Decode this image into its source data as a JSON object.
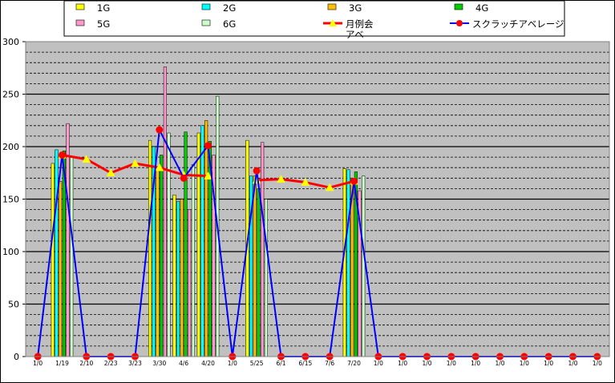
{
  "chart_data": {
    "type": "bar",
    "title": "",
    "xlabel": "",
    "ylabel": "",
    "ylim": [
      0,
      300
    ],
    "yticks": [
      0,
      50,
      100,
      150,
      200,
      250,
      300
    ],
    "grid": true,
    "legend_position": "top",
    "plot_background": "#c0c0c0",
    "categories": [
      "1/0",
      "1/19",
      "2/10",
      "2/23",
      "3/23",
      "3/30",
      "4/6",
      "4/20",
      "1/0",
      "5/25",
      "6/1",
      "6/15",
      "7/6",
      "7/20",
      "1/0",
      "1/0",
      "1/0",
      "1/0",
      "1/0",
      "1/0",
      "1/0",
      "1/0",
      "1/0",
      "1/0"
    ],
    "series": [
      {
        "name": "1G",
        "kind": "bar",
        "color": "#ffff00",
        "values": [
          0,
          184,
          0,
          0,
          0,
          206,
          154,
          213,
          0,
          206,
          0,
          0,
          0,
          179,
          0,
          0,
          0,
          0,
          0,
          0,
          0,
          0,
          0,
          0
        ]
      },
      {
        "name": "2G",
        "kind": "bar",
        "color": "#00ffff",
        "values": [
          0,
          197,
          0,
          0,
          0,
          200,
          148,
          220,
          0,
          172,
          0,
          0,
          0,
          178,
          0,
          0,
          0,
          0,
          0,
          0,
          0,
          0,
          0,
          0
        ]
      },
      {
        "name": "3G",
        "kind": "bar",
        "color": "#ffc000",
        "values": [
          0,
          167,
          0,
          0,
          0,
          178,
          150,
          225,
          0,
          172,
          0,
          0,
          0,
          170,
          0,
          0,
          0,
          0,
          0,
          0,
          0,
          0,
          0,
          0
        ]
      },
      {
        "name": "4G",
        "kind": "bar",
        "color": "#00cc00",
        "values": [
          0,
          196,
          0,
          0,
          0,
          192,
          214,
          205,
          0,
          160,
          0,
          0,
          0,
          176,
          0,
          0,
          0,
          0,
          0,
          0,
          0,
          0,
          0,
          0
        ]
      },
      {
        "name": "5G",
        "kind": "bar",
        "color": "#ff99cc",
        "values": [
          0,
          222,
          0,
          0,
          0,
          276,
          140,
          192,
          0,
          204,
          0,
          0,
          0,
          158,
          0,
          0,
          0,
          0,
          0,
          0,
          0,
          0,
          0,
          0
        ]
      },
      {
        "name": "6G",
        "kind": "bar",
        "color": "#ccffcc",
        "values": [
          0,
          190,
          0,
          0,
          0,
          213,
          183,
          248,
          0,
          150,
          0,
          0,
          0,
          172,
          0,
          0,
          0,
          0,
          0,
          0,
          0,
          0,
          0,
          0
        ]
      },
      {
        "name": "月例会アベ",
        "kind": "line",
        "color": "#ff0000",
        "marker": "triangle",
        "marker_color": "#ffff00",
        "values": [
          null,
          192,
          188,
          175,
          184,
          180,
          173,
          172,
          null,
          168,
          169,
          166,
          161,
          167,
          null,
          null,
          null,
          null,
          null,
          null,
          null,
          null,
          null,
          null
        ]
      },
      {
        "name": "スクラッチアベレージ",
        "kind": "line",
        "color": "#0000ff",
        "marker": "circle",
        "marker_color": "#ff0000",
        "values": [
          0,
          192,
          0,
          0,
          0,
          216,
          170,
          201,
          0,
          177,
          0,
          0,
          0,
          167,
          0,
          0,
          0,
          0,
          0,
          0,
          0,
          0,
          0,
          0
        ]
      }
    ]
  }
}
